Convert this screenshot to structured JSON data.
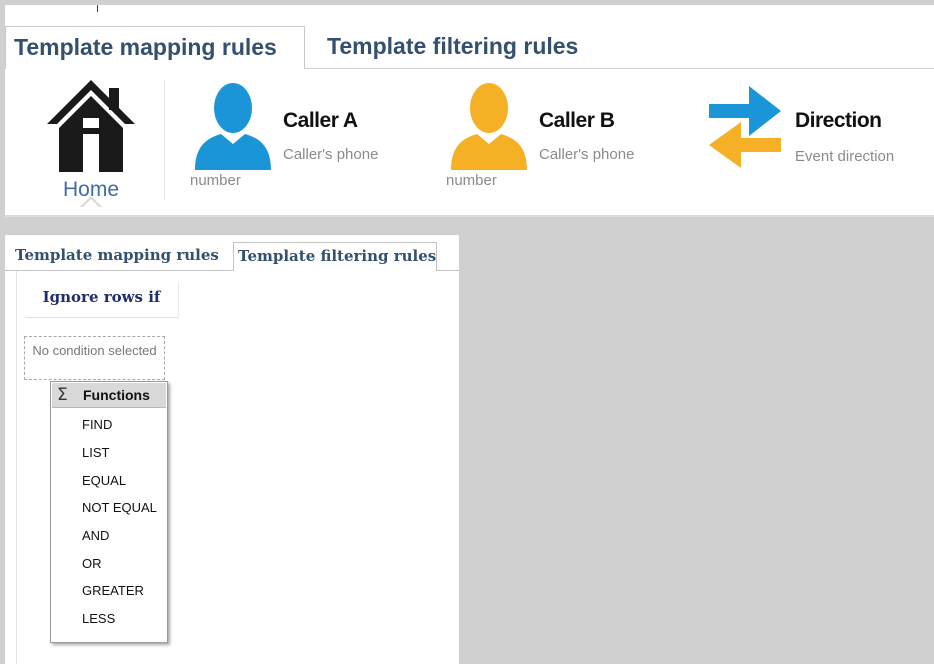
{
  "top": {
    "tabs": [
      {
        "label": "Template mapping rules",
        "active": true
      },
      {
        "label": "Template filtering rules",
        "active": false
      }
    ],
    "ribbon": {
      "home_label": "Home",
      "fields": [
        {
          "title": "Caller A",
          "subtitle": "Caller's phone",
          "subtitle2": "number",
          "icon": "person-icon",
          "color": "#1a96d8"
        },
        {
          "title": "Caller B",
          "subtitle": "Caller's phone",
          "subtitle2": "number",
          "icon": "person-icon",
          "color": "#f5b026"
        },
        {
          "title": "Direction",
          "subtitle": "Event direction",
          "icon": "swap-arrows-icon",
          "color_right": "#1a96d8",
          "color_left": "#f5b026"
        }
      ]
    }
  },
  "bottom": {
    "tabs": [
      {
        "label": "Template mapping rules",
        "active": false
      },
      {
        "label": "Template filtering rules",
        "active": true
      }
    ],
    "ignore_header": "Ignore rows if",
    "no_condition": "No condition selected",
    "menu": {
      "title": "Functions",
      "icon": "sigma-icon",
      "items": [
        "FIND",
        "LIST",
        "EQUAL",
        "NOT EQUAL",
        "AND",
        "OR",
        "GREATER",
        "LESS"
      ]
    }
  }
}
